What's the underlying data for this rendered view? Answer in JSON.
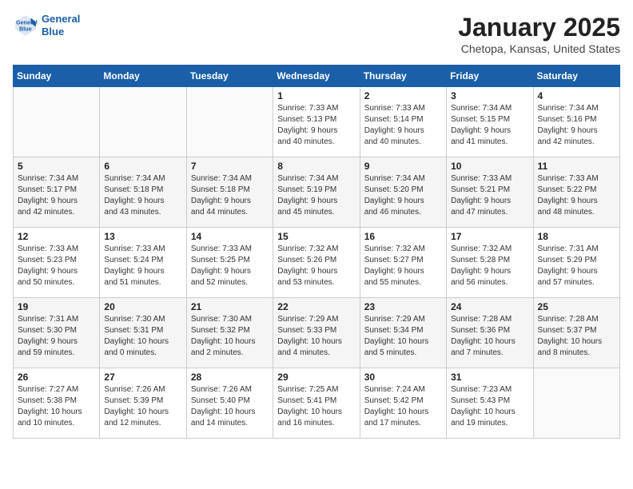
{
  "logo": {
    "line1": "General",
    "line2": "Blue"
  },
  "title": "January 2025",
  "subtitle": "Chetopa, Kansas, United States",
  "headers": [
    "Sunday",
    "Monday",
    "Tuesday",
    "Wednesday",
    "Thursday",
    "Friday",
    "Saturday"
  ],
  "weeks": [
    [
      {
        "num": "",
        "info": ""
      },
      {
        "num": "",
        "info": ""
      },
      {
        "num": "",
        "info": ""
      },
      {
        "num": "1",
        "info": "Sunrise: 7:33 AM\nSunset: 5:13 PM\nDaylight: 9 hours\nand 40 minutes."
      },
      {
        "num": "2",
        "info": "Sunrise: 7:33 AM\nSunset: 5:14 PM\nDaylight: 9 hours\nand 40 minutes."
      },
      {
        "num": "3",
        "info": "Sunrise: 7:34 AM\nSunset: 5:15 PM\nDaylight: 9 hours\nand 41 minutes."
      },
      {
        "num": "4",
        "info": "Sunrise: 7:34 AM\nSunset: 5:16 PM\nDaylight: 9 hours\nand 42 minutes."
      }
    ],
    [
      {
        "num": "5",
        "info": "Sunrise: 7:34 AM\nSunset: 5:17 PM\nDaylight: 9 hours\nand 42 minutes."
      },
      {
        "num": "6",
        "info": "Sunrise: 7:34 AM\nSunset: 5:18 PM\nDaylight: 9 hours\nand 43 minutes."
      },
      {
        "num": "7",
        "info": "Sunrise: 7:34 AM\nSunset: 5:18 PM\nDaylight: 9 hours\nand 44 minutes."
      },
      {
        "num": "8",
        "info": "Sunrise: 7:34 AM\nSunset: 5:19 PM\nDaylight: 9 hours\nand 45 minutes."
      },
      {
        "num": "9",
        "info": "Sunrise: 7:34 AM\nSunset: 5:20 PM\nDaylight: 9 hours\nand 46 minutes."
      },
      {
        "num": "10",
        "info": "Sunrise: 7:33 AM\nSunset: 5:21 PM\nDaylight: 9 hours\nand 47 minutes."
      },
      {
        "num": "11",
        "info": "Sunrise: 7:33 AM\nSunset: 5:22 PM\nDaylight: 9 hours\nand 48 minutes."
      }
    ],
    [
      {
        "num": "12",
        "info": "Sunrise: 7:33 AM\nSunset: 5:23 PM\nDaylight: 9 hours\nand 50 minutes."
      },
      {
        "num": "13",
        "info": "Sunrise: 7:33 AM\nSunset: 5:24 PM\nDaylight: 9 hours\nand 51 minutes."
      },
      {
        "num": "14",
        "info": "Sunrise: 7:33 AM\nSunset: 5:25 PM\nDaylight: 9 hours\nand 52 minutes."
      },
      {
        "num": "15",
        "info": "Sunrise: 7:32 AM\nSunset: 5:26 PM\nDaylight: 9 hours\nand 53 minutes."
      },
      {
        "num": "16",
        "info": "Sunrise: 7:32 AM\nSunset: 5:27 PM\nDaylight: 9 hours\nand 55 minutes."
      },
      {
        "num": "17",
        "info": "Sunrise: 7:32 AM\nSunset: 5:28 PM\nDaylight: 9 hours\nand 56 minutes."
      },
      {
        "num": "18",
        "info": "Sunrise: 7:31 AM\nSunset: 5:29 PM\nDaylight: 9 hours\nand 57 minutes."
      }
    ],
    [
      {
        "num": "19",
        "info": "Sunrise: 7:31 AM\nSunset: 5:30 PM\nDaylight: 9 hours\nand 59 minutes."
      },
      {
        "num": "20",
        "info": "Sunrise: 7:30 AM\nSunset: 5:31 PM\nDaylight: 10 hours\nand 0 minutes."
      },
      {
        "num": "21",
        "info": "Sunrise: 7:30 AM\nSunset: 5:32 PM\nDaylight: 10 hours\nand 2 minutes."
      },
      {
        "num": "22",
        "info": "Sunrise: 7:29 AM\nSunset: 5:33 PM\nDaylight: 10 hours\nand 4 minutes."
      },
      {
        "num": "23",
        "info": "Sunrise: 7:29 AM\nSunset: 5:34 PM\nDaylight: 10 hours\nand 5 minutes."
      },
      {
        "num": "24",
        "info": "Sunrise: 7:28 AM\nSunset: 5:36 PM\nDaylight: 10 hours\nand 7 minutes."
      },
      {
        "num": "25",
        "info": "Sunrise: 7:28 AM\nSunset: 5:37 PM\nDaylight: 10 hours\nand 8 minutes."
      }
    ],
    [
      {
        "num": "26",
        "info": "Sunrise: 7:27 AM\nSunset: 5:38 PM\nDaylight: 10 hours\nand 10 minutes."
      },
      {
        "num": "27",
        "info": "Sunrise: 7:26 AM\nSunset: 5:39 PM\nDaylight: 10 hours\nand 12 minutes."
      },
      {
        "num": "28",
        "info": "Sunrise: 7:26 AM\nSunset: 5:40 PM\nDaylight: 10 hours\nand 14 minutes."
      },
      {
        "num": "29",
        "info": "Sunrise: 7:25 AM\nSunset: 5:41 PM\nDaylight: 10 hours\nand 16 minutes."
      },
      {
        "num": "30",
        "info": "Sunrise: 7:24 AM\nSunset: 5:42 PM\nDaylight: 10 hours\nand 17 minutes."
      },
      {
        "num": "31",
        "info": "Sunrise: 7:23 AM\nSunset: 5:43 PM\nDaylight: 10 hours\nand 19 minutes."
      },
      {
        "num": "",
        "info": ""
      }
    ]
  ]
}
